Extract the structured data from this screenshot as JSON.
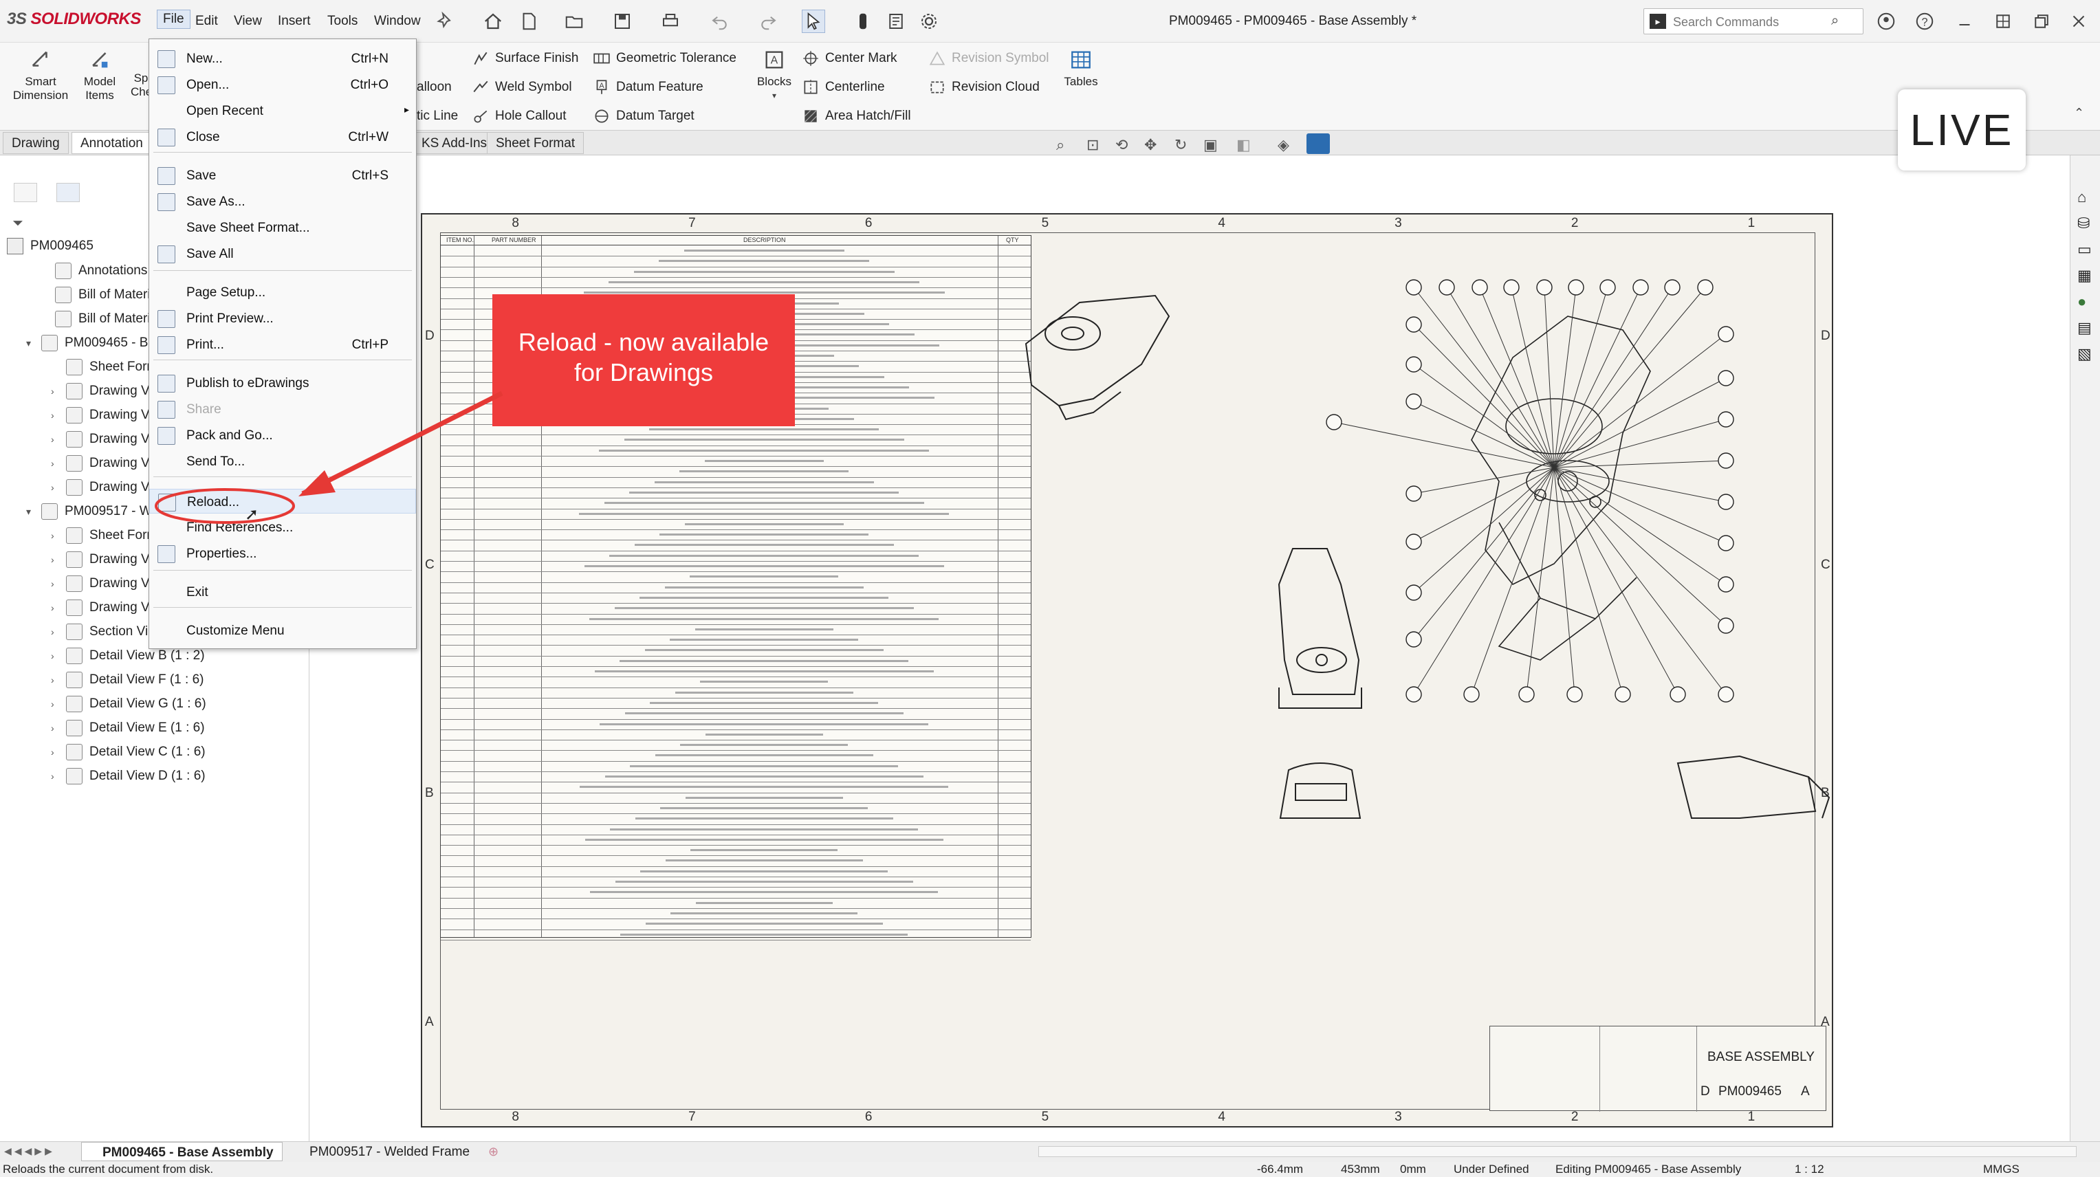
{
  "app": {
    "logo_brand": "3S",
    "logo_name": "SOLIDWORKS",
    "doc_title": "PM009465 - PM009465 - Base Assembly *"
  },
  "menubar": [
    "File",
    "Edit",
    "View",
    "Insert",
    "Tools",
    "Window"
  ],
  "search": {
    "placeholder": "Search Commands"
  },
  "commands": {
    "smart_dimension": "Smart\nDimension",
    "model_items": "Model\nItems",
    "spell": "Sp\nChe",
    "balloon": "alloon",
    "magnetic_line": "tic Line",
    "surface_finish": "Surface Finish",
    "weld_symbol": "Weld Symbol",
    "hole_callout": "Hole Callout",
    "geometric_tolerance": "Geometric Tolerance",
    "datum_feature": "Datum Feature",
    "datum_target": "Datum Target",
    "blocks": "Blocks",
    "center_mark": "Center Mark",
    "centerline": "Centerline",
    "area_hatch": "Area Hatch/Fill",
    "revision_symbol": "Revision Symbol",
    "revision_cloud": "Revision Cloud",
    "tables": "Tables"
  },
  "tabs": [
    "Drawing",
    "Annotation",
    "KS Add-Ins",
    "Sheet Format"
  ],
  "tree": {
    "root": "PM009465",
    "items": [
      "Annotations",
      "Bill of Materials1",
      "Bill of Materials2",
      "PM009465 - Base",
      "Sheet Forma",
      "Drawing Vie",
      "Drawing Vie",
      "Drawing Vie",
      "Drawing Vie",
      "Drawing Vie",
      "PM009517 - Wel",
      "Sheet Forma",
      "Drawing Vie",
      "Drawing Vie",
      "Drawing Vie",
      "Section View",
      "Detail View B (1 : 2)",
      "Detail View F (1 : 6)",
      "Detail View G (1 : 6)",
      "Detail View E (1 : 6)",
      "Detail View C (1 : 6)",
      "Detail View D (1 : 6)"
    ]
  },
  "file_menu": [
    {
      "label": "New...",
      "shortcut": "Ctrl+N"
    },
    {
      "label": "Open...",
      "shortcut": "Ctrl+O"
    },
    {
      "label": "Open Recent",
      "shortcut": ""
    },
    {
      "label": "Close",
      "shortcut": "Ctrl+W"
    },
    {
      "label": "Save",
      "shortcut": "Ctrl+S"
    },
    {
      "label": "Save As...",
      "shortcut": ""
    },
    {
      "label": "Save Sheet Format...",
      "shortcut": ""
    },
    {
      "label": "Save All",
      "shortcut": ""
    },
    {
      "label": "Page Setup...",
      "shortcut": ""
    },
    {
      "label": "Print Preview...",
      "shortcut": ""
    },
    {
      "label": "Print...",
      "shortcut": "Ctrl+P"
    },
    {
      "label": "Publish to eDrawings",
      "shortcut": ""
    },
    {
      "label": "Share",
      "shortcut": ""
    },
    {
      "label": "Pack and Go...",
      "shortcut": ""
    },
    {
      "label": "Send To...",
      "shortcut": ""
    },
    {
      "label": "Reload...",
      "shortcut": ""
    },
    {
      "label": "Find References...",
      "shortcut": ""
    },
    {
      "label": "Properties...",
      "shortcut": ""
    },
    {
      "label": "Exit",
      "shortcut": ""
    },
    {
      "label": "Customize Menu",
      "shortcut": ""
    }
  ],
  "callout": {
    "line1": "Reload - now available",
    "line2": "for Drawings"
  },
  "live_badge": "LIVE",
  "sheet": {
    "top_zones": [
      "8",
      "7",
      "6",
      "5",
      "4",
      "3",
      "2",
      "1"
    ],
    "side_zones": [
      "D",
      "C",
      "B",
      "A"
    ],
    "title_block": {
      "title": "BASE ASSEMBLY",
      "size": "D",
      "doc_no": "PM009465",
      "rev": "A"
    },
    "bom_headers": [
      "ITEM NO.",
      "PART NUMBER",
      "DESCRIPTION",
      "QTY"
    ]
  },
  "sheet_tabs": [
    "PM009465 - Base Assembly",
    "PM009517 - Welded Frame"
  ],
  "status": {
    "message": "Reloads the current document from disk.",
    "x": "-66.4mm",
    "y": "453mm",
    "z": "0mm",
    "state": "Under Defined",
    "editing": "Editing PM009465 - Base Assembly",
    "scale": "1 : 12",
    "units": "MMGS"
  }
}
